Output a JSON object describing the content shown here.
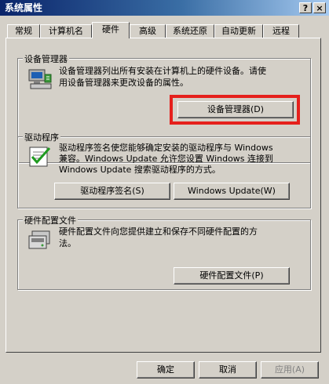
{
  "window": {
    "title": "系统属性",
    "help_label": "?",
    "close_label": "×"
  },
  "tabs": [
    {
      "label": "常规"
    },
    {
      "label": "计算机名"
    },
    {
      "label": "硬件"
    },
    {
      "label": "高级"
    },
    {
      "label": "系统还原"
    },
    {
      "label": "自动更新"
    },
    {
      "label": "远程"
    }
  ],
  "active_tab": "硬件",
  "device_manager": {
    "group_title": "设备管理器",
    "description_line1": "设备管理器列出所有安装在计算机上的硬件设备。请使",
    "description_line2": "用设备管理器来更改设备的属性。",
    "button_label": "设备管理器(D)",
    "highlight_color": "#e5201c"
  },
  "drivers": {
    "group_title": "驱动程序",
    "description_line1": "驱动程序签名使您能够确定安装的驱动程序与 Windows",
    "description_line2": "兼容。Windows Update 允许您设置 Windows 连接到",
    "description_line3": "Windows Update 搜索驱动程序的方式。",
    "signing_button_label": "驱动程序签名(S)",
    "update_button_label": "Windows Update(W)"
  },
  "hardware_profiles": {
    "group_title": "硬件配置文件",
    "description_line1": "硬件配置文件向您提供建立和保存不同硬件配置的方",
    "description_line2": "法。",
    "button_label": "硬件配置文件(P)"
  },
  "footer": {
    "ok_label": "确定",
    "cancel_label": "取消",
    "apply_label": "应用(A)"
  }
}
